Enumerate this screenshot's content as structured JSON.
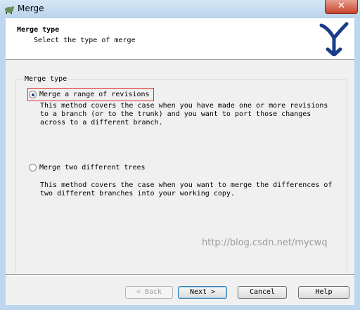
{
  "window": {
    "title": "Merge",
    "close_label": "✕"
  },
  "header": {
    "title": "Merge type",
    "subtitle": "Select the type of merge"
  },
  "group": {
    "label": "Merge type"
  },
  "options": [
    {
      "label": "Merge a range of revisions",
      "selected": true,
      "description": "This method covers the case when you have made one or more revisions\nto a branch (or to the trunk) and you want to port those changes\nacross to a different branch."
    },
    {
      "label": "Merge two different trees",
      "selected": false,
      "description": "This method covers the case when you want to merge the differences of\ntwo different branches into your working copy."
    }
  ],
  "watermark": "http://blog.csdn.net/mycwq",
  "buttons": {
    "back": "< Back",
    "next": "Next >",
    "cancel": "Cancel",
    "help": "Help"
  },
  "colors": {
    "accent": "#1d3e6f",
    "highlight_box": "#e03030",
    "logo": "#1a3d8a"
  }
}
